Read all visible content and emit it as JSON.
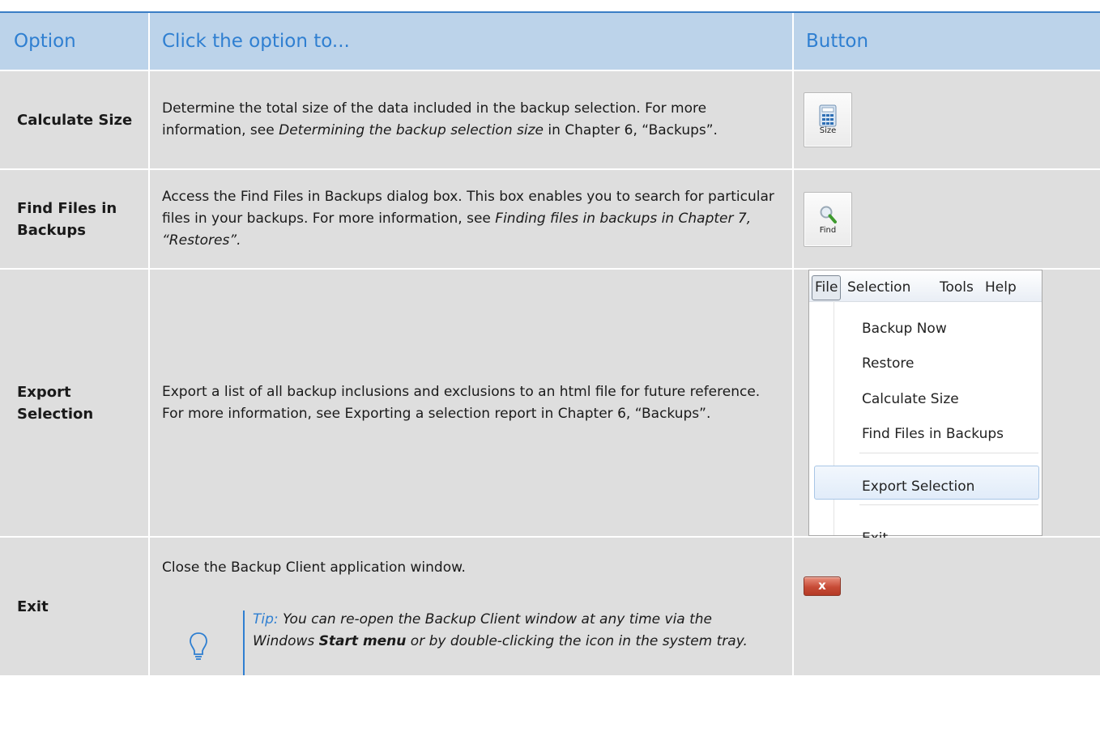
{
  "header": {
    "col1": "Option",
    "col2": "Click the option to...",
    "col3": "Button"
  },
  "rows": [
    {
      "option": "Calculate Size",
      "desc_plain": "Determine the total size of the data included in the backup selection. For more information, see ",
      "desc_italic": "Determining the backup selection size",
      "desc_tail": " in Chapter 6, “Backups”.",
      "button_label": "Size",
      "button_icon": "calculator-icon"
    },
    {
      "option": "Find Files in Backups",
      "desc_plain": "Access the Find Files in Backups dialog box. This box enables you to search for particular files in your backups. For more information, see ",
      "desc_italic": "Finding files in backups in Chapter 7, “Restores”.",
      "button_label": "Find",
      "button_icon": "magnifier-icon"
    },
    {
      "option": "Export Selection",
      "desc": "Export a list of all backup inclusions and exclusions to an html file for future reference. For more information, see Exporting a selection report in Chapter 6, “Backups”.",
      "menu": {
        "bar": [
          "File",
          "Selection",
          "Tools",
          "Help"
        ],
        "items": [
          "Backup Now",
          "Restore",
          "Calculate Size",
          "Find Files in Backups",
          "Export Selection",
          "Exit"
        ],
        "highlighted": "Export Selection"
      }
    },
    {
      "option": "Exit",
      "desc": "Close the Backup Client application window.",
      "tip": {
        "label": "Tip:",
        "text_a": " You can re-open the Backup Client window at any time via the Windows ",
        "text_b": "Start menu",
        "text_c": " or by double-clicking the icon in the system tray."
      },
      "button_glyph": "x",
      "button_icon": "close-icon"
    }
  ],
  "colors": {
    "accent": "#2f7fd1",
    "header_bg": "#bcd3ea",
    "row_bg": "#dedede",
    "close_red": "#c74b36"
  }
}
